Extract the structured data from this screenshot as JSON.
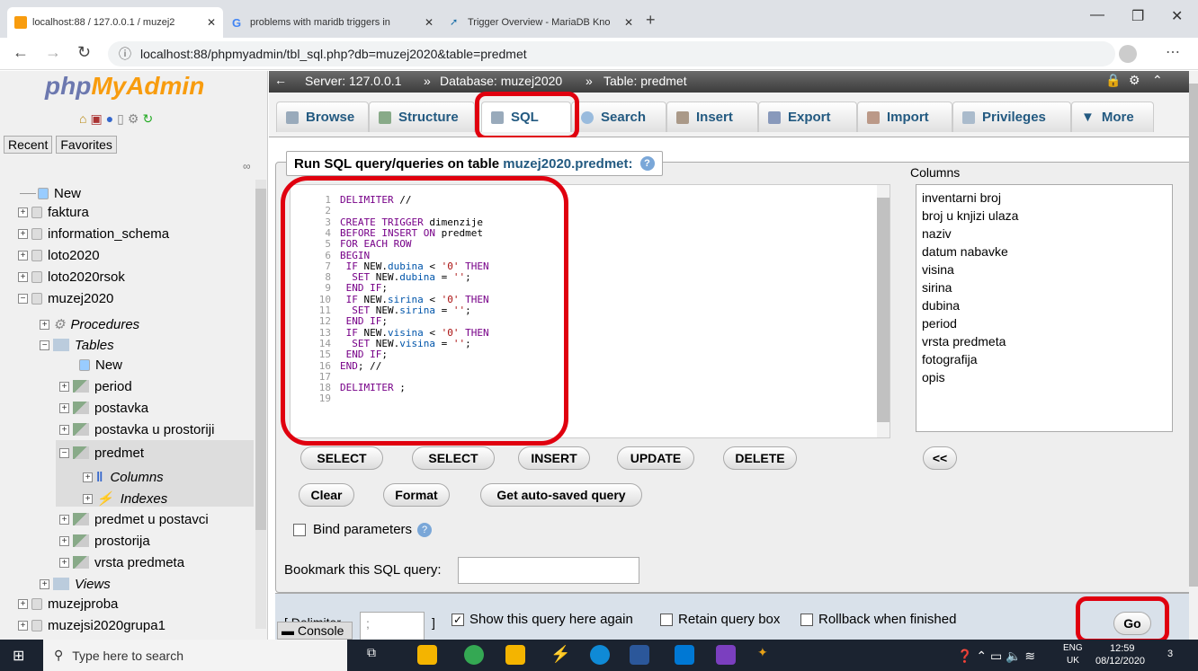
{
  "browser": {
    "tabs": [
      {
        "title": "localhost:88 / 127.0.0.1 / muzej2"
      },
      {
        "title": "problems with maridb triggers in"
      },
      {
        "title": "Trigger Overview - MariaDB Kno"
      }
    ],
    "url": "localhost:88/phpmyadmin/tbl_sql.php?db=muzej2020&table=predmet"
  },
  "pma": {
    "logo_a": "php",
    "logo_b": "MyAdmin",
    "recent": "Recent",
    "favorites": "Favorites",
    "tree": [
      {
        "label": "New"
      },
      {
        "label": "faktura"
      },
      {
        "label": "information_schema"
      },
      {
        "label": "loto2020"
      },
      {
        "label": "loto2020rsok"
      },
      {
        "label": "muzej2020"
      },
      {
        "label": "Procedures"
      },
      {
        "label": "Tables"
      },
      {
        "label": "New"
      },
      {
        "label": "period"
      },
      {
        "label": "postavka"
      },
      {
        "label": "postavka u prostoriji"
      },
      {
        "label": "predmet"
      },
      {
        "label": "Columns"
      },
      {
        "label": "Indexes"
      },
      {
        "label": "predmet u postavci"
      },
      {
        "label": "prostorija"
      },
      {
        "label": "vrsta predmeta"
      },
      {
        "label": "Views"
      },
      {
        "label": "muzejproba"
      },
      {
        "label": "muzejsi2020grupa1"
      }
    ],
    "breadcrumb": {
      "server": "Server: 127.0.0.1",
      "db": "Database: muzej2020",
      "table": "Table: predmet"
    },
    "tabs": [
      "Browse",
      "Structure",
      "SQL",
      "Search",
      "Insert",
      "Export",
      "Import",
      "Privileges",
      "More"
    ],
    "legend_prefix": "Run SQL query/queries on table ",
    "legend_link": "muzej2020.predmet:",
    "columns_label": "Columns",
    "columns": [
      "inventarni broj",
      "broj u knjizi ulaza",
      "naziv",
      "datum nabavke",
      "visina",
      "sirina",
      "dubina",
      "period",
      "vrsta predmeta",
      "fotografija",
      "opis"
    ],
    "sql_buttons": [
      "SELECT",
      "SELECT",
      "INSERT",
      "UPDATE",
      "DELETE"
    ],
    "insert_btn": "<<",
    "action_buttons": [
      "Clear",
      "Format",
      "Get auto-saved query"
    ],
    "bind_params": "Bind parameters",
    "bookmark_label": "Bookmark this SQL query:",
    "delimiter_label": "[ Delimiter",
    "delimiter_value": ";",
    "delimiter_close": "]",
    "show_again": "Show this query here again",
    "retain": "Retain query box",
    "rollback": "Rollback when finished",
    "go": "Go",
    "console": "Console"
  },
  "code": [
    "DELIMITER //",
    "",
    "CREATE TRIGGER dimenzije",
    "BEFORE INSERT ON predmet",
    "FOR EACH ROW",
    "BEGIN",
    " IF NEW.dubina < '0' THEN",
    "  SET NEW.dubina = '';",
    " END IF;",
    " IF NEW.sirina < '0' THEN",
    "  SET NEW.sirina = '';",
    " END IF;",
    " IF NEW.visina < '0' THEN",
    "  SET NEW.visina = '';",
    " END IF;",
    "END; //",
    "",
    "DELIMITER ;",
    ""
  ],
  "taskbar": {
    "search": "Type here to search",
    "lang": "ENG",
    "region": "UK",
    "time": "12:59",
    "date": "08/12/2020",
    "notif": "3"
  }
}
